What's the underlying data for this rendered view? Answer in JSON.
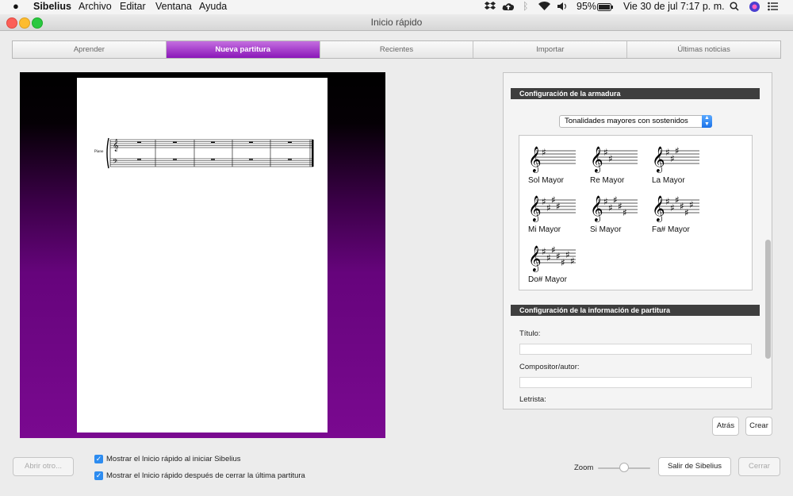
{
  "menubar": {
    "app_name": "Sibelius",
    "items": [
      "Archivo",
      "Editar",
      "Ventana",
      "Ayuda"
    ],
    "battery": "95%",
    "datetime": "Vie 30 de jul  7:17 p. m."
  },
  "window": {
    "title": "Inicio rápido"
  },
  "tabs": [
    {
      "label": "Aprender"
    },
    {
      "label": "Nueva partitura",
      "active": true
    },
    {
      "label": "Recientes"
    },
    {
      "label": "Importar"
    },
    {
      "label": "Últimas noticias"
    }
  ],
  "score_preview": {
    "instrument": "Piano"
  },
  "key_section": {
    "header": "Configuración de la armadura",
    "dropdown_value": "Tonalidades mayores con sostenidos",
    "keys": [
      {
        "label": "Sol Mayor",
        "sharps": 1
      },
      {
        "label": "Re Mayor",
        "sharps": 2
      },
      {
        "label": "La Mayor",
        "sharps": 3
      },
      {
        "label": "Mi Mayor",
        "sharps": 4
      },
      {
        "label": "Si Mayor",
        "sharps": 5
      },
      {
        "label": "Fa# Mayor",
        "sharps": 6
      },
      {
        "label": "Do# Mayor",
        "sharps": 7
      }
    ]
  },
  "info_section": {
    "header": "Configuración de la información de partitura",
    "title_label": "Título:",
    "composer_label": "Compositor/autor:",
    "lyricist_label": "Letrista:"
  },
  "buttons": {
    "back": "Atrás",
    "create": "Crear",
    "open_other": "Abrir otro...",
    "quit": "Salir de Sibelius",
    "close": "Cerrar"
  },
  "checkboxes": [
    {
      "label": "Mostrar el Inicio rápido al iniciar Sibelius",
      "checked": true
    },
    {
      "label": "Mostrar el Inicio rápido después de cerrar la última partitura",
      "checked": true
    }
  ],
  "zoom": {
    "label": "Zoom",
    "value": 0.5
  }
}
